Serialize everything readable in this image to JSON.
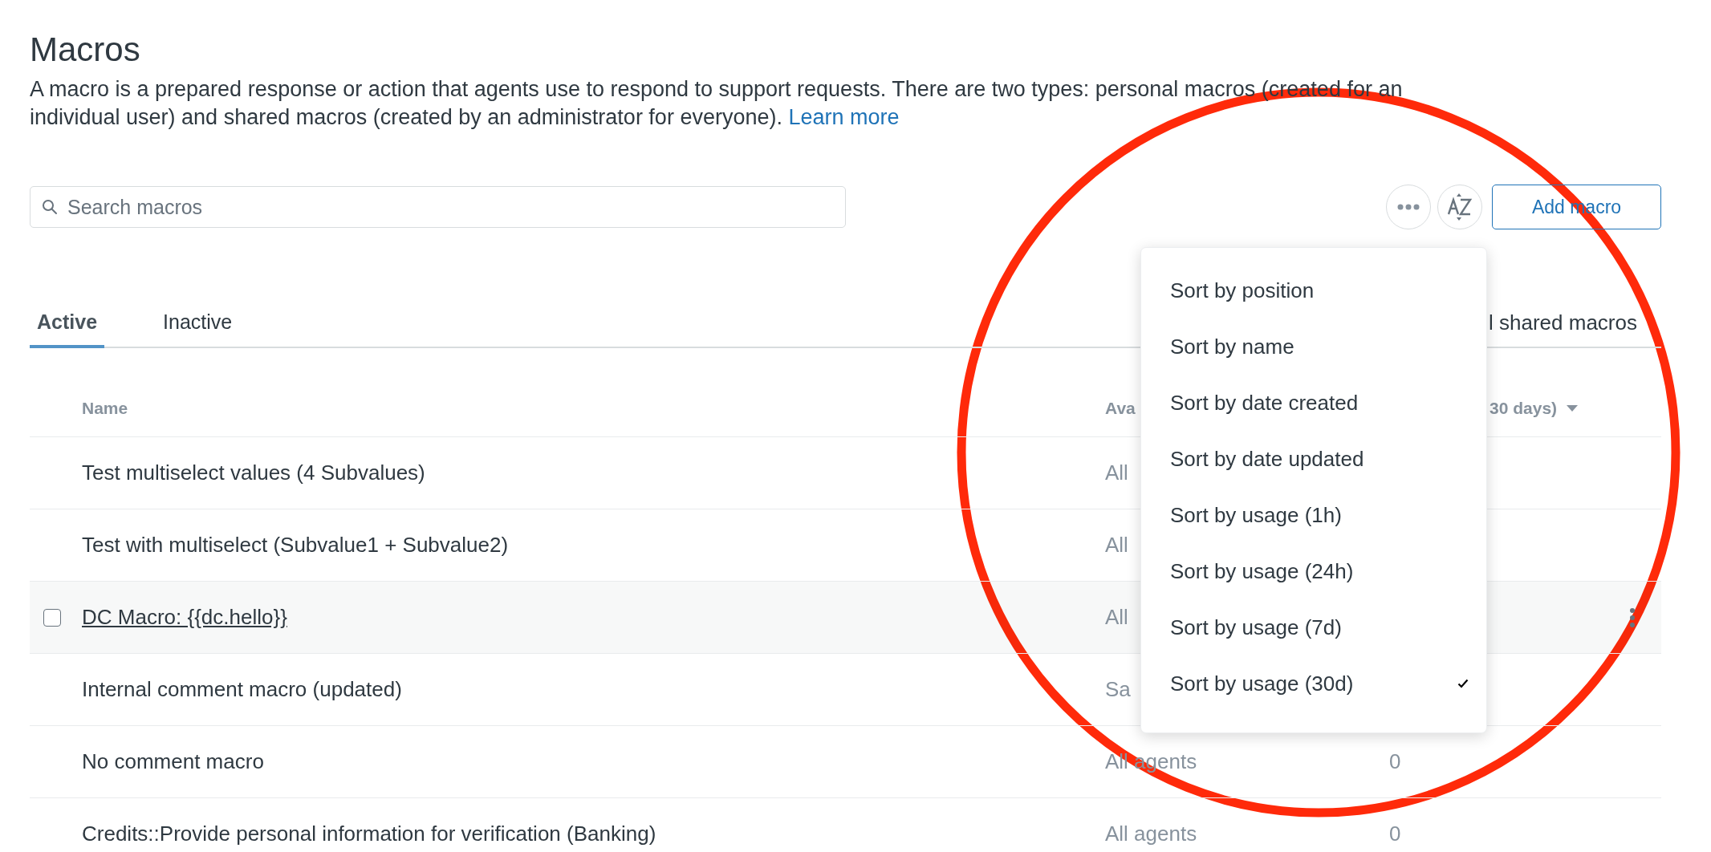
{
  "page": {
    "title": "Macros",
    "description": "A macro is a prepared response or action that agents use to respond to support requests. There are two types: personal macros (created for an individual user) and shared macros (created by an administrator for everyone).",
    "learn_more_link": "Learn more"
  },
  "search": {
    "placeholder": "Search macros"
  },
  "toolbar": {
    "add_button": "Add macro"
  },
  "tabs": [
    {
      "label": "Active",
      "selected": true
    },
    {
      "label": "Inactive",
      "selected": false
    }
  ],
  "filter": {
    "label": "l shared macros"
  },
  "table": {
    "columns": [
      "Name",
      "Ava",
      "30 days)"
    ],
    "rows": [
      {
        "name": "Test multiselect values (4 Subvalues)",
        "availability": "All",
        "hovered": false
      },
      {
        "name": "Test with multiselect (Subvalue1 + Subvalue2)",
        "availability": "All",
        "hovered": false
      },
      {
        "name": "DC Macro: {{dc.hello}}",
        "availability": "All",
        "hovered": true,
        "checked": false
      },
      {
        "name": "Internal comment macro (updated)",
        "availability": "Sa",
        "hovered": false
      },
      {
        "name": "No comment macro",
        "availability": "All agents",
        "usage": "0",
        "hovered": false
      },
      {
        "name": "Credits::Provide personal information for verification (Banking)",
        "availability": "All agents",
        "usage": "0",
        "hovered": false
      }
    ]
  },
  "sort_menu": {
    "items": [
      {
        "label": "Sort by position",
        "selected": false
      },
      {
        "label": "Sort by name",
        "selected": false
      },
      {
        "label": "Sort by date created",
        "selected": false
      },
      {
        "label": "Sort by date updated",
        "selected": false
      },
      {
        "label": "Sort by usage (1h)",
        "selected": false
      },
      {
        "label": "Sort by usage (24h)",
        "selected": false
      },
      {
        "label": "Sort by usage (7d)",
        "selected": false
      },
      {
        "label": "Sort by usage (30d)",
        "selected": true
      }
    ]
  }
}
